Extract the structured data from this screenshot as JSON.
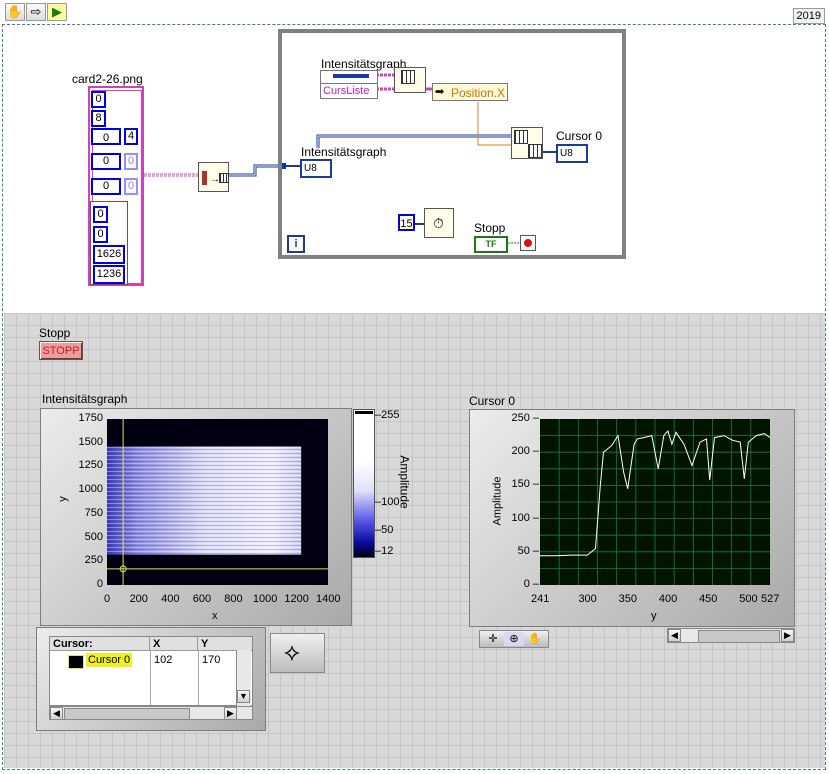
{
  "toolbar": {
    "tools": [
      "hand-icon",
      "arrow-icon",
      "run-icon"
    ],
    "version": "2019"
  },
  "block_diagram": {
    "file_label": "card2-26.png",
    "cluster_values": [
      "0",
      "8",
      "0",
      "4",
      "0",
      "0",
      "0",
      "0"
    ],
    "inner_cluster_values": [
      "0",
      "0",
      "1626",
      "1236"
    ],
    "loop_label_intensity_top": "Intensitätsgraph",
    "curs_liste": "CursListe",
    "position_x": "Position.X",
    "intensity_label": "Intensitätsgraph",
    "u8_label": "U8",
    "cursor0_label": "Cursor 0",
    "cursor0_u8": "U8",
    "wait_ms": "15",
    "stopp_label": "Stopp",
    "tf_label": "TF",
    "iteration": "i"
  },
  "front_panel": {
    "stop_label": "Stopp",
    "stop_button": "STOPP",
    "intensity_graph": {
      "label": "Intensitätsgraph",
      "x_axis_label": "x",
      "y_axis_label": "y",
      "x_ticks": [
        "0",
        "200",
        "400",
        "600",
        "800",
        "1000",
        "1200",
        "1400"
      ],
      "y_ticks": [
        "1750",
        "1500",
        "1250",
        "1000",
        "750",
        "500",
        "250",
        "0"
      ],
      "colorbar_label": "Amplitude",
      "colorbar_ticks": [
        "255",
        "100",
        "50",
        "12"
      ]
    },
    "cursor_table": {
      "headers": [
        "Cursor:",
        "X",
        "Y"
      ],
      "rows": [
        {
          "name": "Cursor 0",
          "x": "102",
          "y": "170"
        }
      ]
    },
    "cursor_graph": {
      "label": "Cursor 0",
      "x_axis_label": "y",
      "y_axis_label": "Amplitude",
      "x_ticks": [
        "241",
        "300",
        "350",
        "400",
        "450",
        "500",
        "527"
      ],
      "y_ticks": [
        "250",
        "200",
        "150",
        "100",
        "50",
        "0"
      ]
    }
  },
  "chart_data": [
    {
      "type": "heatmap",
      "title": "Intensitätsgraph",
      "xlabel": "x",
      "ylabel": "y",
      "xlim": [
        0,
        1400
      ],
      "ylim": [
        0,
        1750
      ],
      "data_extent": {
        "x": [
          0,
          1230
        ],
        "y": [
          320,
          1460
        ]
      },
      "z_label": "Amplitude",
      "zlim": [
        12,
        255
      ],
      "cursor": {
        "x": 102,
        "y": 170
      }
    },
    {
      "type": "line",
      "title": "Cursor 0",
      "xlabel": "y",
      "ylabel": "Amplitude",
      "xlim": [
        241,
        527
      ],
      "ylim": [
        0,
        250
      ],
      "grid": true,
      "x": [
        241,
        260,
        280,
        300,
        310,
        316,
        320,
        330,
        338,
        345,
        350,
        358,
        362,
        370,
        380,
        388,
        395,
        400,
        405,
        410,
        420,
        430,
        440,
        448,
        452,
        458,
        470,
        480,
        490,
        495,
        500,
        505,
        510,
        520,
        527
      ],
      "y": [
        44,
        44,
        45,
        45,
        55,
        150,
        200,
        210,
        225,
        170,
        145,
        212,
        220,
        222,
        225,
        175,
        225,
        232,
        212,
        230,
        212,
        180,
        215,
        220,
        158,
        222,
        225,
        218,
        215,
        160,
        215,
        220,
        225,
        228,
        222
      ]
    }
  ]
}
